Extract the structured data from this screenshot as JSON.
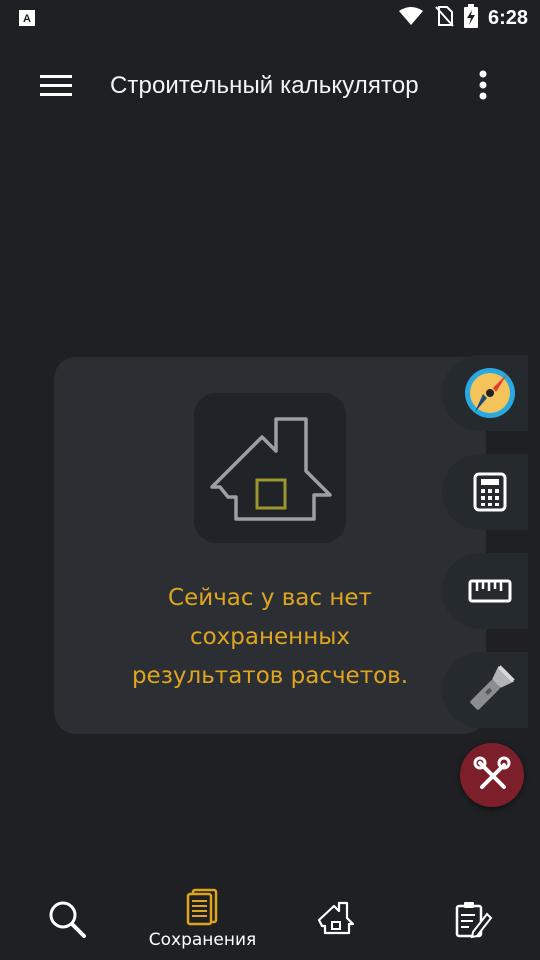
{
  "status_bar": {
    "time": "6:28",
    "notification_icon": "font-a-icon",
    "wifi_icon": "wifi-icon",
    "no_sim_icon": "no-sim-icon",
    "battery_icon": "battery-charging-icon"
  },
  "app_bar": {
    "title": "Строительный калькулятор",
    "menu_icon": "hamburger-menu-icon",
    "more_icon": "more-vertical-icon"
  },
  "empty_state": {
    "icon": "house-icon",
    "line1": "Сейчас у вас нет",
    "line2": "сохраненных",
    "line3": "результатов расчетов."
  },
  "tools": [
    {
      "name": "compass-icon"
    },
    {
      "name": "calculator-icon"
    },
    {
      "name": "ruler-icon"
    },
    {
      "name": "flashlight-icon"
    }
  ],
  "fab": {
    "icon": "tools-icon"
  },
  "bottom_nav": {
    "items": [
      {
        "icon": "search-icon",
        "label": ""
      },
      {
        "icon": "saved-docs-icon",
        "label": "Сохранения",
        "active": true
      },
      {
        "icon": "house-icon",
        "label": ""
      },
      {
        "icon": "notes-edit-icon",
        "label": ""
      }
    ]
  },
  "colors": {
    "background": "#1e2023",
    "card": "#2b2f34",
    "accent": "#e0a51f",
    "fab": "#7d1f2a"
  }
}
